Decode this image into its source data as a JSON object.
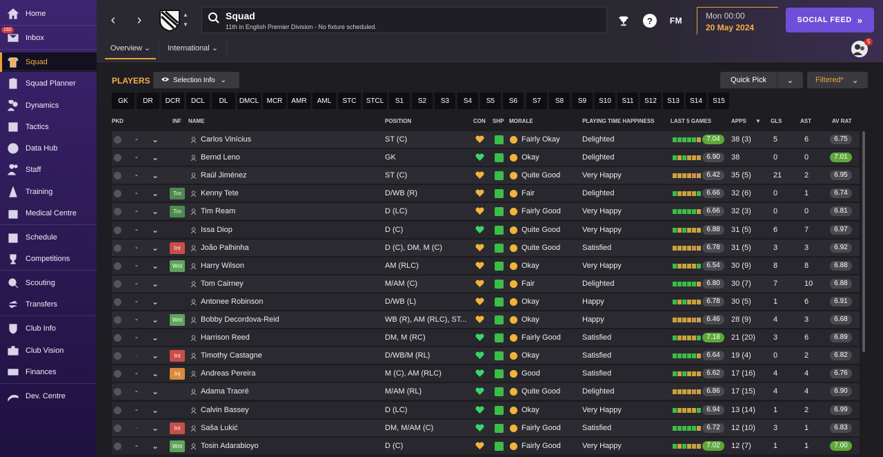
{
  "sidebar": {
    "inbox_badge": "160",
    "items": [
      {
        "label": "Home",
        "icon": "home-icon"
      },
      {
        "label": "Inbox",
        "icon": "inbox-icon"
      },
      {
        "label": "Squad",
        "icon": "squad-icon"
      },
      {
        "label": "Squad Planner",
        "icon": "clipboard-icon"
      },
      {
        "label": "Dynamics",
        "icon": "dynamics-icon"
      },
      {
        "label": "Tactics",
        "icon": "tactics-icon"
      },
      {
        "label": "Data Hub",
        "icon": "data-hub-icon"
      },
      {
        "label": "Staff",
        "icon": "staff-icon"
      },
      {
        "label": "Training",
        "icon": "training-icon"
      },
      {
        "label": "Medical Centre",
        "icon": "medical-icon"
      },
      {
        "label": "Schedule",
        "icon": "calendar-icon"
      },
      {
        "label": "Competitions",
        "icon": "trophy-icon"
      },
      {
        "label": "Scouting",
        "icon": "scouting-icon"
      },
      {
        "label": "Transfers",
        "icon": "transfers-icon"
      },
      {
        "label": "Club Info",
        "icon": "shield-icon"
      },
      {
        "label": "Club Vision",
        "icon": "briefcase-icon"
      },
      {
        "label": "Finances",
        "icon": "money-icon"
      },
      {
        "label": "Dev. Centre",
        "icon": "dev-centre-icon"
      }
    ]
  },
  "header": {
    "title": "Squad",
    "subtitle": "11th in English Premier Division - No fixture scheduled.",
    "date_time": "Mon 00:00",
    "date_day": "20 May 2024",
    "fm_logo": "FM",
    "help": "?",
    "social_feed": "SOCIAL FEED",
    "tabs": [
      "Overview",
      "International"
    ],
    "avatar_badge": "5"
  },
  "toolbar": {
    "players_label": "PLAYERS",
    "selection_info": "Selection Info",
    "quick_pick": "Quick Pick",
    "filtered": "Filtered*"
  },
  "positions": [
    "GK",
    "DR",
    "DCR",
    "DCL",
    "DL",
    "DMCL",
    "MCR",
    "AMR",
    "AML",
    "STC",
    "STCL",
    "S1",
    "S2",
    "S3",
    "S4",
    "S5",
    "S6",
    "S7",
    "S8",
    "S9",
    "S10",
    "S11",
    "S12",
    "S13",
    "S14",
    "S15"
  ],
  "columns": {
    "pkd": "PKD",
    "inf": "INF",
    "name": "NAME",
    "position": "POSITION",
    "con": "CON",
    "shp": "SHP",
    "morale": "MORALE",
    "pth": "PLAYING TIME HAPPINESS",
    "last5": "LAST 5 GAMES",
    "apps": "APPS",
    "gls": "GLS",
    "ast": "AST",
    "avrat": "AV RAT"
  },
  "colors": {
    "accent": "#e8a23a",
    "social": "#6f4fd8",
    "green_pill": "#5ea83a",
    "trn": "#4f8a4e",
    "int": "#c94d4a",
    "wnt": "#5ea35b",
    "inj": "#d98a3c"
  },
  "players": [
    {
      "pick": "-",
      "inf": "",
      "name": "Carlos Vinícius",
      "position": "ST (C)",
      "morale": "Fairly Okay",
      "pth": "Delighted",
      "avg5": "7.04",
      "avg5_hi": true,
      "apps": "38 (3)",
      "gls": "5",
      "ast": "6",
      "rating": "6.75",
      "rating_hi": false,
      "con": "gold"
    },
    {
      "pick": "-",
      "inf": "",
      "name": "Bernd Leno",
      "position": "GK",
      "morale": "Okay",
      "pth": "Delighted",
      "avg5": "6.90",
      "avg5_hi": false,
      "apps": "38",
      "gls": "0",
      "ast": "0",
      "rating": "7.01",
      "rating_hi": true,
      "con": "green"
    },
    {
      "pick": "-",
      "inf": "",
      "name": "Raúl Jiménez",
      "position": "ST (C)",
      "morale": "Quite Good",
      "pth": "Very Happy",
      "avg5": "6.42",
      "avg5_hi": false,
      "apps": "35 (5)",
      "gls": "21",
      "ast": "2",
      "rating": "6.95",
      "rating_hi": false,
      "con": "gold"
    },
    {
      "pick": "-",
      "inf": "Trn",
      "name": "Kenny Tete",
      "position": "D/WB (R)",
      "morale": "Fair",
      "pth": "Delighted",
      "avg5": "6.66",
      "avg5_hi": false,
      "apps": "32 (6)",
      "gls": "0",
      "ast": "1",
      "rating": "6.74",
      "rating_hi": false,
      "con": "gold"
    },
    {
      "pick": "-",
      "inf": "Trn",
      "name": "Tim Ream",
      "position": "D (LC)",
      "morale": "Fairly Good",
      "pth": "Very Happy",
      "avg5": "6.66",
      "avg5_hi": false,
      "apps": "32 (3)",
      "gls": "0",
      "ast": "0",
      "rating": "6.81",
      "rating_hi": false,
      "con": "gold"
    },
    {
      "pick": "-",
      "inf": "",
      "name": "Issa Diop",
      "position": "D (C)",
      "morale": "Quite Good",
      "pth": "Very Happy",
      "avg5": "6.88",
      "avg5_hi": false,
      "apps": "31 (5)",
      "gls": "6",
      "ast": "7",
      "rating": "6.97",
      "rating_hi": false,
      "con": "green"
    },
    {
      "pick": "-",
      "inf": "Int",
      "name": "João Palhinha",
      "position": "D (C), DM, M (C)",
      "morale": "Quite Good",
      "pth": "Satisfied",
      "avg5": "6.78",
      "avg5_hi": false,
      "apps": "31 (5)",
      "gls": "3",
      "ast": "3",
      "rating": "6.92",
      "rating_hi": false,
      "con": "gold"
    },
    {
      "pick": "-",
      "inf": "Wnt",
      "name": "Harry Wilson",
      "position": "AM (RLC)",
      "morale": "Okay",
      "pth": "Very Happy",
      "avg5": "6.54",
      "avg5_hi": false,
      "apps": "30 (9)",
      "gls": "8",
      "ast": "8",
      "rating": "6.88",
      "rating_hi": false,
      "con": "gold"
    },
    {
      "pick": "-",
      "inf": "",
      "name": "Tom Cairney",
      "position": "M/AM (C)",
      "morale": "Fair",
      "pth": "Delighted",
      "avg5": "6.80",
      "avg5_hi": false,
      "apps": "30 (7)",
      "gls": "7",
      "ast": "10",
      "rating": "6.88",
      "rating_hi": false,
      "con": "gold"
    },
    {
      "pick": "-",
      "inf": "",
      "name": "Antonee Robinson",
      "position": "D/WB (L)",
      "morale": "Okay",
      "pth": "Happy",
      "avg5": "6.78",
      "avg5_hi": false,
      "apps": "30 (5)",
      "gls": "1",
      "ast": "6",
      "rating": "6.91",
      "rating_hi": false,
      "con": "gold"
    },
    {
      "pick": "-",
      "inf": "Wnt",
      "name": "Bobby Decordova-Reid",
      "position": "WB (R), AM (RLC), ST...",
      "morale": "Okay",
      "pth": "Happy",
      "avg5": "6.46",
      "avg5_hi": false,
      "apps": "28 (9)",
      "gls": "4",
      "ast": "3",
      "rating": "6.68",
      "rating_hi": false,
      "con": "gold"
    },
    {
      "pick": "-",
      "inf": "",
      "name": "Harrison Reed",
      "position": "DM, M (RC)",
      "morale": "Fairly Good",
      "pth": "Satisfied",
      "avg5": "7.18",
      "avg5_hi": true,
      "apps": "21 (20)",
      "gls": "3",
      "ast": "6",
      "rating": "6.89",
      "rating_hi": false,
      "con": "green"
    },
    {
      "pick": "-",
      "inf": "Int",
      "name": "Timothy Castagne",
      "position": "D/WB/M (RL)",
      "morale": "Okay",
      "pth": "Satisfied",
      "avg5": "6.64",
      "avg5_hi": false,
      "apps": "19 (4)",
      "gls": "0",
      "ast": "2",
      "rating": "6.82",
      "rating_hi": false,
      "con": "green"
    },
    {
      "pick": "-",
      "inf": "Inj",
      "name": "Andreas Pereira",
      "position": "M (C), AM (RLC)",
      "morale": "Good",
      "pth": "Satisfied",
      "avg5": "6.62",
      "avg5_hi": false,
      "apps": "17 (16)",
      "gls": "4",
      "ast": "4",
      "rating": "6.76",
      "rating_hi": false,
      "con": "green"
    },
    {
      "pick": "-",
      "inf": "",
      "name": "Adama Traoré",
      "position": "M/AM (RL)",
      "morale": "Quite Good",
      "pth": "Delighted",
      "avg5": "6.86",
      "avg5_hi": false,
      "apps": "17 (15)",
      "gls": "4",
      "ast": "4",
      "rating": "6.90",
      "rating_hi": false,
      "con": "green"
    },
    {
      "pick": "-",
      "inf": "",
      "name": "Calvin Bassey",
      "position": "D (LC)",
      "morale": "Okay",
      "pth": "Very Happy",
      "avg5": "6.94",
      "avg5_hi": false,
      "apps": "13 (14)",
      "gls": "1",
      "ast": "2",
      "rating": "6.99",
      "rating_hi": false,
      "con": "green"
    },
    {
      "pick": "-",
      "inf": "Int",
      "name": "Saša Lukić",
      "position": "DM, M/AM (C)",
      "morale": "Fairly Good",
      "pth": "Satisfied",
      "avg5": "6.72",
      "avg5_hi": false,
      "apps": "12 (10)",
      "gls": "3",
      "ast": "1",
      "rating": "6.83",
      "rating_hi": false,
      "con": "green"
    },
    {
      "pick": "-",
      "inf": "Wnt",
      "name": "Tosin Adarabioyo",
      "position": "D (C)",
      "morale": "Fairly Good",
      "pth": "Very Happy",
      "avg5": "7.02",
      "avg5_hi": true,
      "apps": "12 (7)",
      "gls": "1",
      "ast": "1",
      "rating": "7.00",
      "rating_hi": true,
      "con": "gold"
    }
  ]
}
